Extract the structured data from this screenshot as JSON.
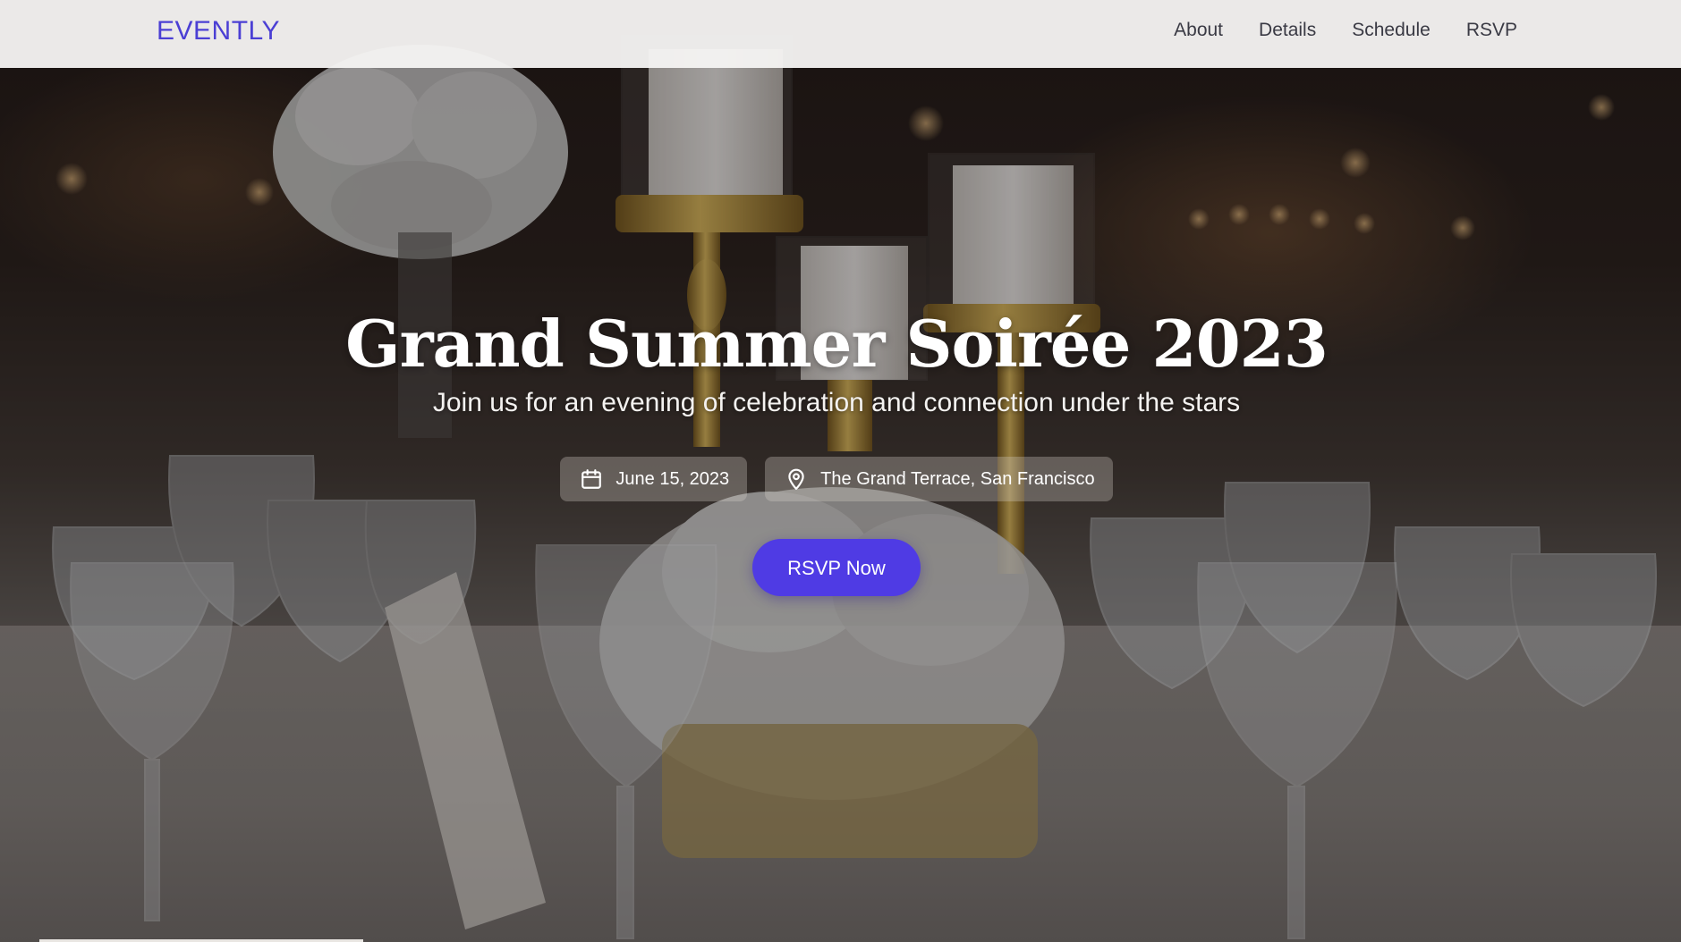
{
  "header": {
    "brand": "EVENTLY",
    "nav": [
      "About",
      "Details",
      "Schedule",
      "RSVP"
    ]
  },
  "hero": {
    "title": "Grand Summer Soirée 2023",
    "subtitle": "Join us for an evening of celebration and connection under the stars",
    "date": {
      "icon": "calendar-icon",
      "text": "June 15, 2023"
    },
    "location": {
      "icon": "map-pin-icon",
      "text": "The Grand Terrace, San Francisco"
    },
    "cta_label": "RSVP Now"
  },
  "colors": {
    "brand": "#4b3fd4",
    "cta": "#4f3be4",
    "nav_text": "#3a3a44",
    "header_bg": "#f4f3f1"
  }
}
